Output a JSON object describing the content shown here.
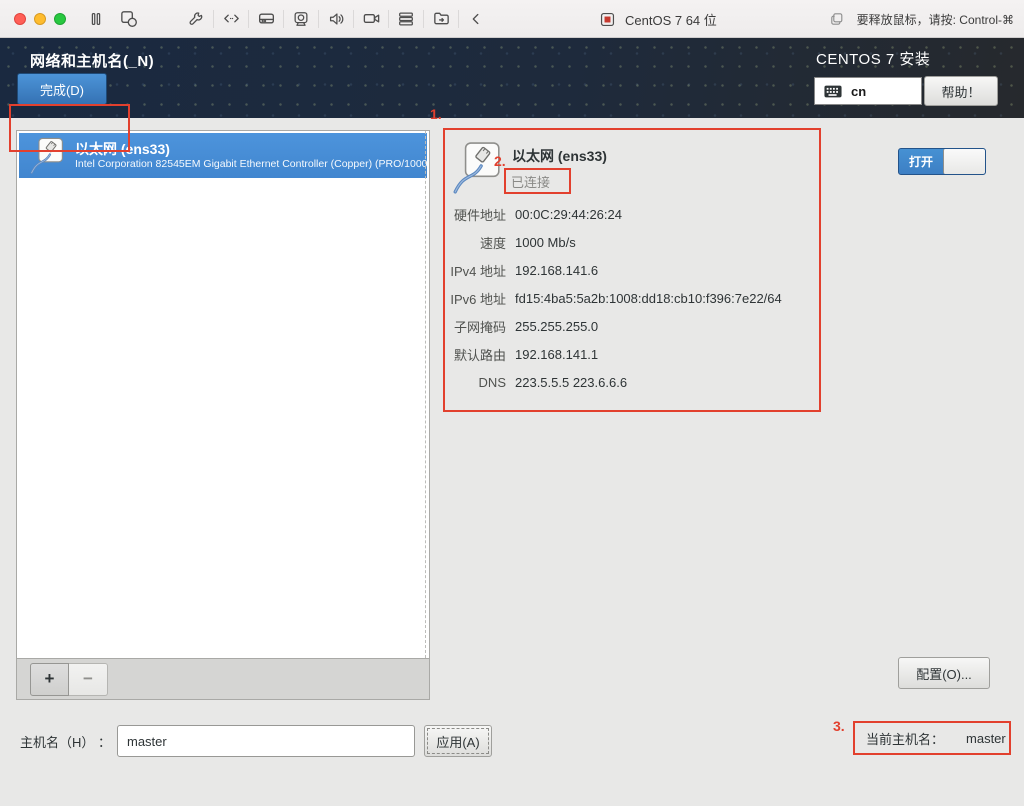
{
  "colors": {
    "accent_blue": "#4a90d9",
    "annotation_red": "#e2402e",
    "header_navy": "#1a2940"
  },
  "macos_bar": {
    "title": "CentOS 7 64 位",
    "release_hint": "要释放鼠标，请按: Control-⌘",
    "icons": [
      "pause-icon",
      "snapshot-icon",
      "wrench-icon",
      "code-arrows-icon",
      "disk-icon",
      "camera-icon",
      "speaker-icon",
      "video-camera-icon",
      "server-icon",
      "shared-folder-icon",
      "collapse-chevron-icon"
    ]
  },
  "header": {
    "spoke_title": "网络和主机名(_N)",
    "done_button": "完成(D)",
    "product_title": "CENTOS 7 安装",
    "keyboard_layout": "cn",
    "help_button": "帮助！"
  },
  "device_list": {
    "selected_device": {
      "name": "以太网 (ens33)",
      "description": "Intel Corporation 82545EM Gigabit Ethernet Controller (Copper) (PRO/1000"
    },
    "add_button": "+",
    "remove_button": "−"
  },
  "detail": {
    "name": "以太网 (ens33)",
    "status": "已连接",
    "switch_on_label": "打开",
    "rows": [
      {
        "label": "硬件地址",
        "value": "00:0C:29:44:26:24"
      },
      {
        "label": "速度",
        "value": "1000 Mb/s"
      },
      {
        "label": "IPv4 地址",
        "value": "192.168.141.6"
      },
      {
        "label": "IPv6 地址",
        "value": "fd15:4ba5:5a2b:1008:dd18:cb10:f396:7e22/64"
      },
      {
        "label": "子网掩码",
        "value": "255.255.255.0"
      },
      {
        "label": "默认路由",
        "value": "192.168.141.1"
      },
      {
        "label": "DNS",
        "value": "223.5.5.5 223.6.6.6"
      }
    ],
    "configure_button": "配置(O)..."
  },
  "hostname_bar": {
    "label": "主机名（H） ：",
    "value": "master",
    "apply_button": "应用(A)",
    "current_label": "当前主机名：",
    "current_value": "master"
  },
  "annotations": {
    "step1": "1.",
    "step2": "2.",
    "step3": "3."
  }
}
